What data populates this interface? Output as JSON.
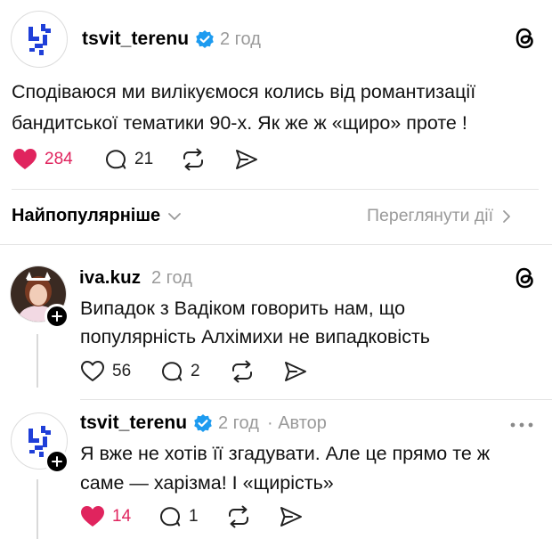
{
  "post": {
    "username": "tsvit_terenu",
    "time": "2 год",
    "text_line1": "Сподіваюся ми вилікуємося колись від романтизації",
    "text_line2": "бандитської тематики 90-х. Як же ж «щиро» проте !",
    "likes": "284",
    "replies": "21"
  },
  "sort_bar": {
    "label": "Найпопулярніше",
    "view_activity": "Переглянути дії"
  },
  "comments": [
    {
      "username": "iva.kuz",
      "time": "2 год",
      "line1": "Випадок з Вадіком говорить нам, що",
      "line2": "популярність Алхімихи не випадковість",
      "likes": "56",
      "replies": "2"
    },
    {
      "username": "tsvit_terenu",
      "time": "2 год",
      "author_tag": "· Автор",
      "line1": "Я вже не хотів її згадувати. Але це прямо те ж",
      "line2": "саме — харізма! І «щирість»",
      "likes": "14",
      "replies": "1"
    }
  ],
  "colors": {
    "like_red": "#e0245e",
    "verified_blue": "#1d9bf0",
    "logo_blue": "#1f3fd8"
  }
}
